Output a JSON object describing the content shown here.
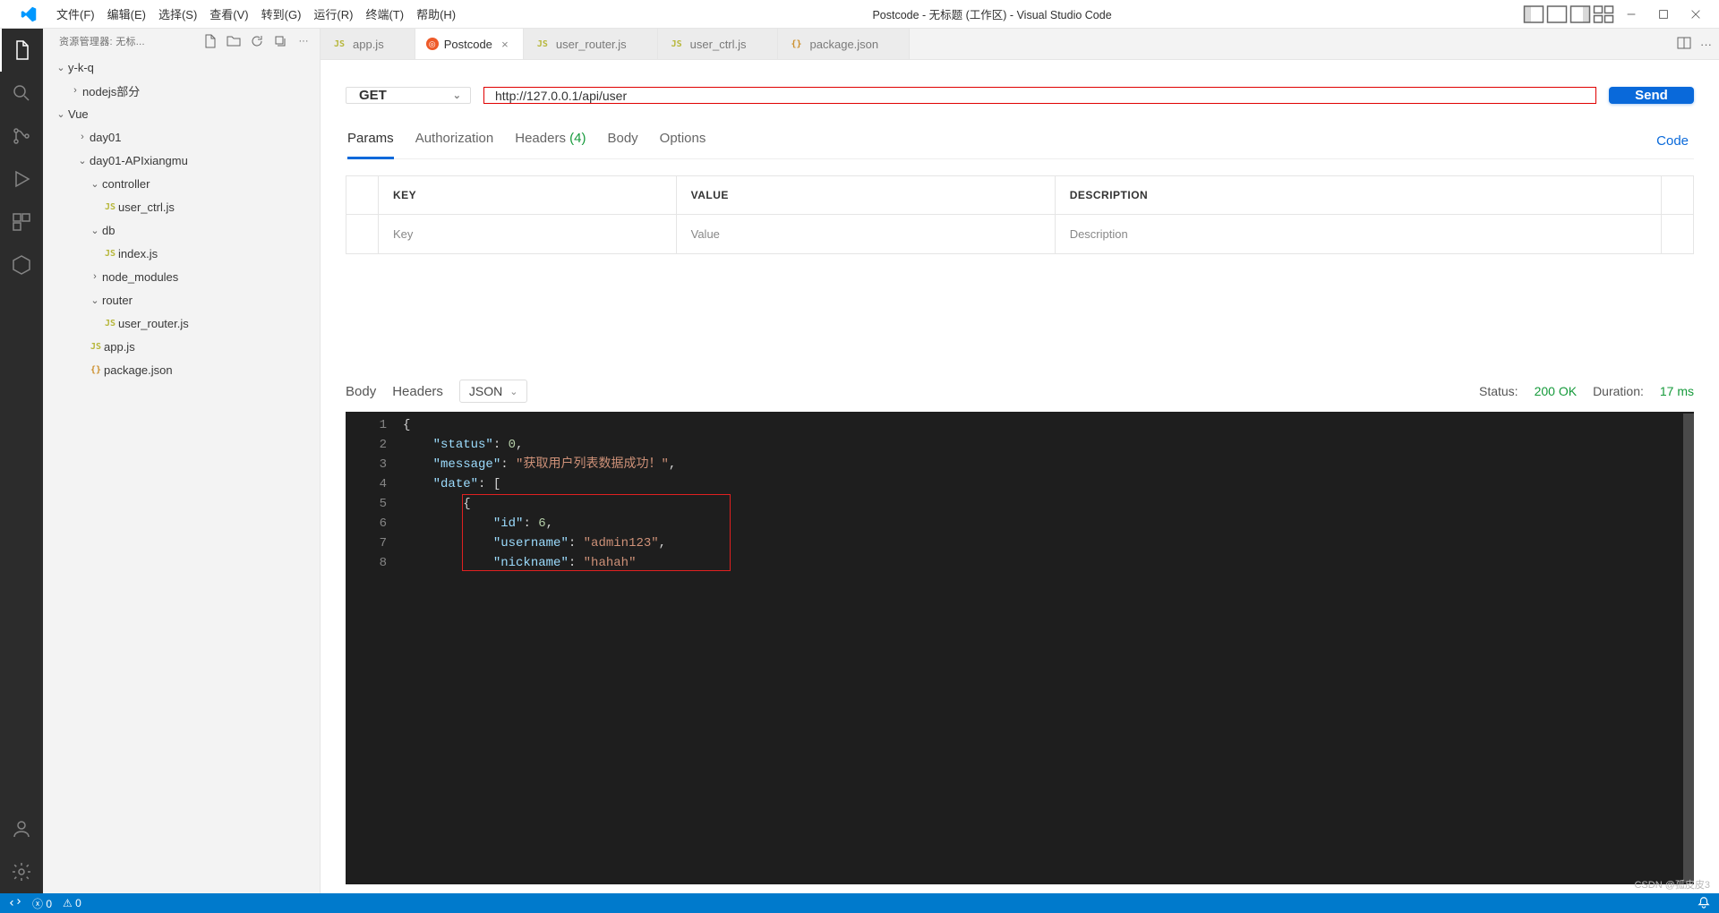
{
  "title": "Postcode - 无标题 (工作区) - Visual Studio Code",
  "menu": [
    "文件(F)",
    "编辑(E)",
    "选择(S)",
    "查看(V)",
    "转到(G)",
    "运行(R)",
    "终端(T)",
    "帮助(H)"
  ],
  "sidebar": {
    "title": "资源管理器: 无标...",
    "tree": {
      "root": "y-k-q",
      "nodejs": "nodejs部分",
      "vue": "Vue",
      "day01": "day01",
      "apixiangmu": "day01-APIxiangmu",
      "controller": "controller",
      "user_ctrl": "user_ctrl.js",
      "db": "db",
      "indexjs": "index.js",
      "node_modules": "node_modules",
      "router": "router",
      "user_router": "user_router.js",
      "appjs": "app.js",
      "packagejson": "package.json"
    }
  },
  "tabs": [
    {
      "icon": "js",
      "label": "app.js",
      "active": false
    },
    {
      "icon": "pc",
      "label": "Postcode",
      "active": true
    },
    {
      "icon": "js",
      "label": "user_router.js",
      "active": false
    },
    {
      "icon": "js",
      "label": "user_ctrl.js",
      "active": false
    },
    {
      "icon": "json",
      "label": "package.json",
      "active": false
    }
  ],
  "request": {
    "method": "GET",
    "url": "http://127.0.0.1/api/user",
    "send": "Send",
    "tabs": {
      "params": "Params",
      "auth": "Authorization",
      "headers": "Headers",
      "headers_count": "(4)",
      "body": "Body",
      "options": "Options",
      "code": "Code"
    },
    "table": {
      "head": {
        "key": "KEY",
        "value": "VALUE",
        "desc": "DESCRIPTION"
      },
      "placeholder": {
        "key": "Key",
        "value": "Value",
        "desc": "Description"
      }
    }
  },
  "response": {
    "tabs": {
      "body": "Body",
      "headers": "Headers"
    },
    "format": "JSON",
    "status_label": "Status:",
    "status_value": "200 OK",
    "duration_label": "Duration:",
    "duration_value": "17 ms",
    "json": {
      "status": 0,
      "message": "获取用户列表数据成功！",
      "date_entry": {
        "id": 6,
        "username": "admin123",
        "nickname": "hahah"
      }
    }
  },
  "statusbar": {
    "errors": "0",
    "warnings": "0"
  },
  "watermark": "CSDN @孤皮皮3"
}
